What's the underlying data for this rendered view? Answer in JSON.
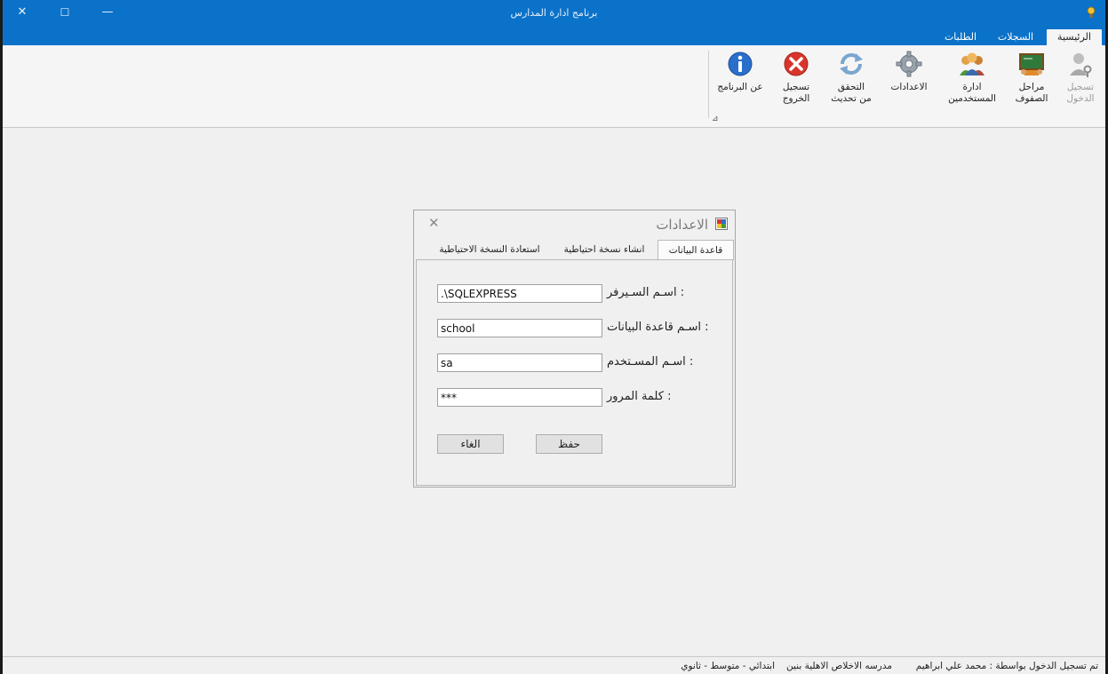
{
  "window": {
    "title": "برنامج ادارة المدارس",
    "controls": {
      "close": "✕",
      "maximize": "☐",
      "minimize": "—"
    }
  },
  "ribbon": {
    "tabs": [
      {
        "label": "الرئيسية",
        "active": true
      },
      {
        "label": "السجلات",
        "active": false
      },
      {
        "label": "الطلبات",
        "active": false
      }
    ],
    "buttons": {
      "login": {
        "line1": "تسجيل",
        "line2": "الدخول",
        "icon": "user-key-icon",
        "enabled": false
      },
      "stages": {
        "line1": "مراحل",
        "line2": "الصفوف",
        "icon": "classroom-icon"
      },
      "users": {
        "line1": "ادارة",
        "line2": "المستخدمين",
        "icon": "users-group-icon"
      },
      "settings": {
        "line1": "الاعدادات",
        "line2": "",
        "icon": "gear-icon"
      },
      "update": {
        "line1": "التحقق",
        "line2": "من تحديث",
        "icon": "refresh-icon"
      },
      "logout": {
        "line1": "تسجيل",
        "line2": "الخروج",
        "icon": "close-circle-icon"
      },
      "about": {
        "line1": "عن البرنامج",
        "line2": "",
        "icon": "info-icon"
      }
    },
    "launcher": "⊿"
  },
  "dialog": {
    "title": "الاعدادات",
    "close": "✕",
    "tabs": [
      {
        "label": "قاعدة البيانات",
        "active": true
      },
      {
        "label": "انشاء نسخة احتياطية",
        "active": false
      },
      {
        "label": "استعادة النسخة الاحتياطية",
        "active": false
      }
    ],
    "fields": {
      "server": {
        "label": "اسـم السـيرفر :",
        "value": ".\\SQLEXPRESS"
      },
      "database": {
        "label": "اسـم قاعدة البيانات :",
        "value": "school"
      },
      "username": {
        "label": "اسـم المسـتخدم :",
        "value": "sa"
      },
      "password": {
        "label": "كلمة المرور :",
        "value": "***"
      }
    },
    "buttons": {
      "save": "حفظ",
      "cancel": "الغاء"
    }
  },
  "status": {
    "logged_in": "تم تسجيل الدخول بواسطة : محمد علي ابراهيم",
    "school": "مدرسه الاخلاص الاهلية بنين",
    "stages": "ابتدائي - متوسط - ثانوي"
  },
  "colors": {
    "titlebar": "#0b72c9",
    "window_bg": "#f0f0f0"
  }
}
